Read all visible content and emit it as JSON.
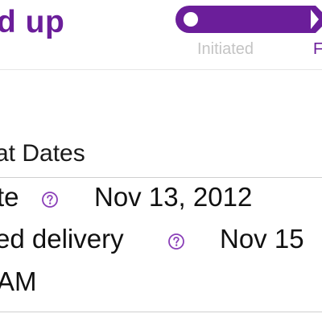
{
  "header": {
    "title": "d up",
    "brand_color": "#6b1e9a"
  },
  "tracker": {
    "steps": [
      {
        "label": "Initiated",
        "state": "complete"
      },
      {
        "label": "F",
        "state": "current"
      }
    ]
  },
  "dates": {
    "heading": "at Dates",
    "rows": [
      {
        "label": "te",
        "help_icon": "question-circle-icon",
        "value": "Nov 13, 2012"
      },
      {
        "label": "ed delivery",
        "help_icon": "question-circle-icon",
        "value": "Nov 15",
        "value_cont": "AM"
      }
    ]
  }
}
